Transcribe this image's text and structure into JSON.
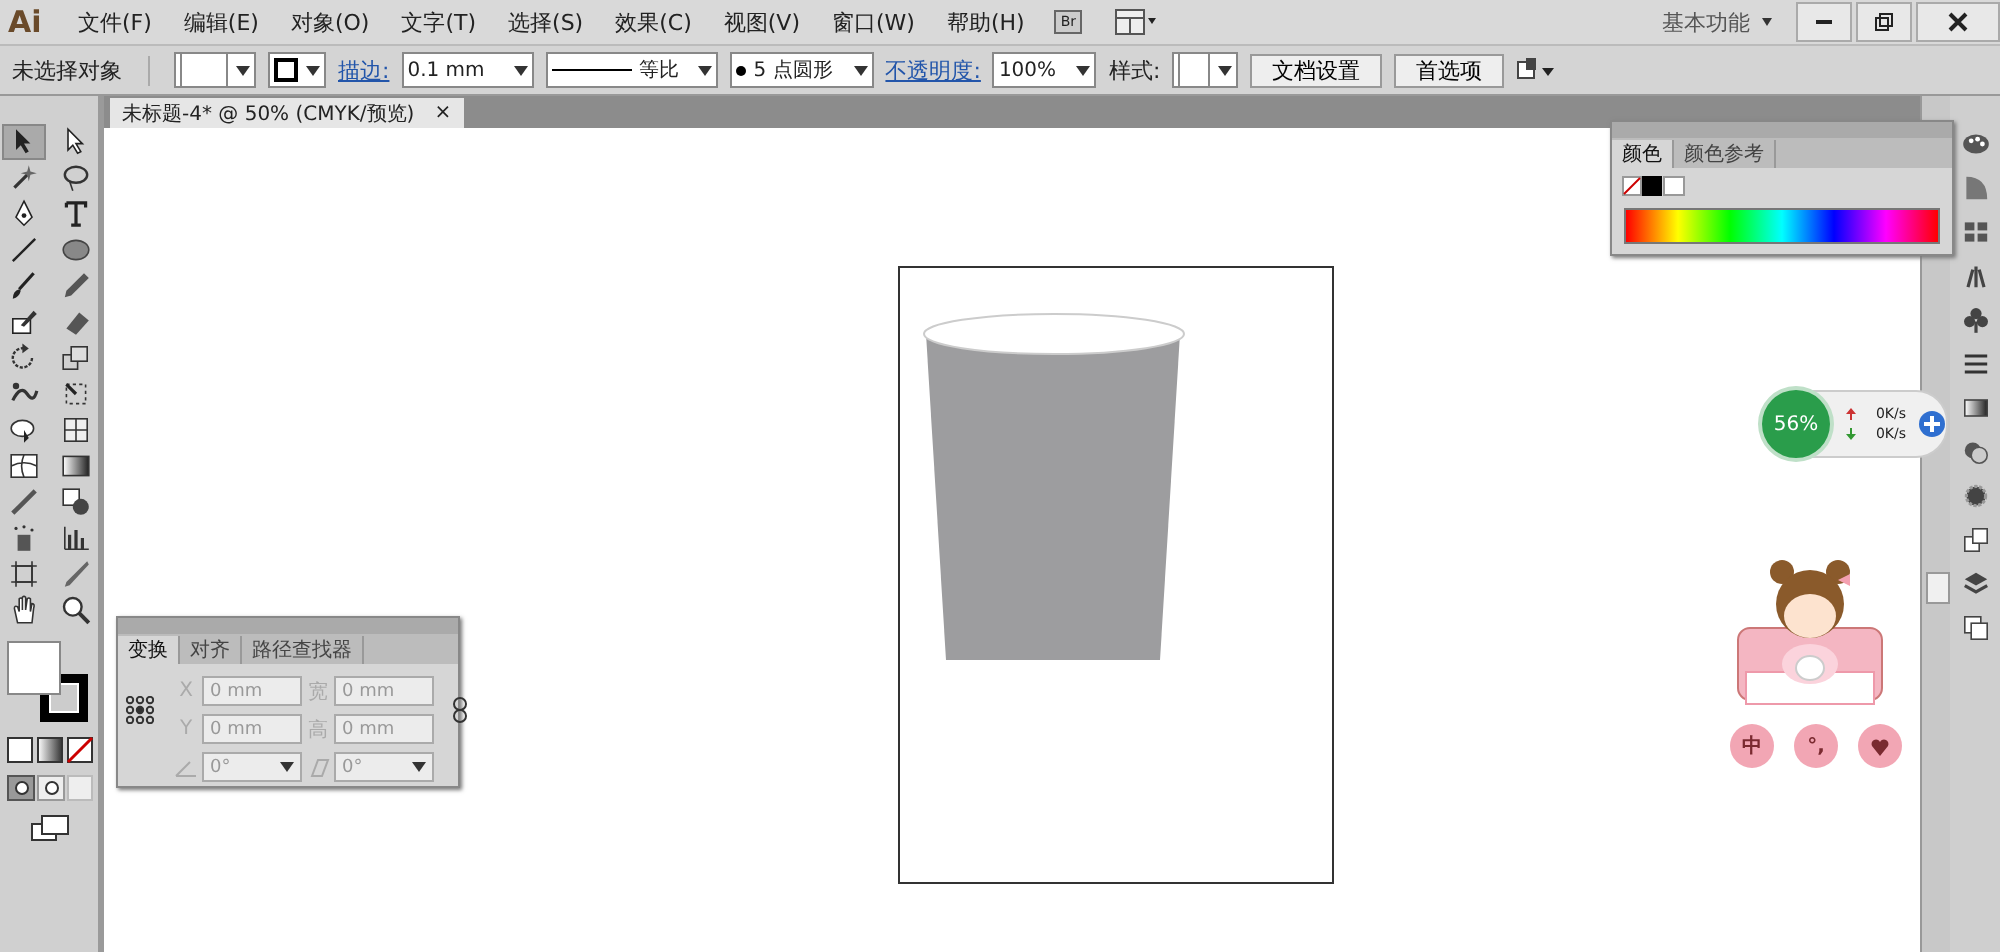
{
  "app": {
    "logo": "Ai",
    "bridge": "Br",
    "workspace": "基本功能"
  },
  "menu": [
    {
      "label": "文件(F)"
    },
    {
      "label": "编辑(E)"
    },
    {
      "label": "对象(O)"
    },
    {
      "label": "文字(T)"
    },
    {
      "label": "选择(S)"
    },
    {
      "label": "效果(C)"
    },
    {
      "label": "视图(V)"
    },
    {
      "label": "窗口(W)"
    },
    {
      "label": "帮助(H)"
    }
  ],
  "options_bar": {
    "selection": "未选择对象",
    "stroke_label": "描边:",
    "stroke_weight": "0.1 mm",
    "stroke_profile": "等比",
    "brush": "5 点圆形",
    "opacity_label": "不透明度:",
    "opacity": "100%",
    "style_label": "样式:",
    "buttons": [
      "文档设置",
      "首选项"
    ]
  },
  "document_tab": {
    "title": "未标题-4* @ 50% (CMYK/预览)",
    "close": "×"
  },
  "tools": [
    {
      "selected": true
    },
    {
      "selected": false
    },
    {
      "selected": false
    },
    {
      "selected": false
    },
    {
      "selected": false
    },
    {
      "selected": false
    },
    {
      "selected": false
    },
    {
      "selected": false
    },
    {
      "selected": false
    },
    {
      "selected": false
    },
    {
      "selected": false
    },
    {
      "selected": false
    },
    {
      "selected": false
    },
    {
      "selected": false
    },
    {
      "selected": false
    },
    {
      "selected": false
    },
    {
      "selected": false
    },
    {
      "selected": false
    },
    {
      "selected": false
    },
    {
      "selected": false
    },
    {
      "selected": false
    },
    {
      "selected": false
    },
    {
      "selected": false
    },
    {
      "selected": false
    },
    {
      "selected": false
    },
    {
      "selected": false
    },
    {
      "selected": false
    },
    {
      "selected": false
    }
  ],
  "color_panel": {
    "tabs": [
      {
        "label": "颜色",
        "selected": true
      },
      {
        "label": "颜色参考",
        "selected": false
      }
    ]
  },
  "transform_panel": {
    "tabs": [
      {
        "label": "变换",
        "selected": true
      },
      {
        "label": "对齐",
        "selected": false
      },
      {
        "label": "路径查找器",
        "selected": false
      }
    ],
    "fields": [
      {
        "label": "X",
        "value": "0 mm",
        "disabled": true
      },
      {
        "label": "宽",
        "value": "0 mm",
        "disabled": true
      },
      {
        "label": "Y",
        "value": "0 mm",
        "disabled": true
      },
      {
        "label": "高",
        "value": "0 mm",
        "disabled": true
      }
    ],
    "angles": [
      {
        "value": "0°",
        "disabled": true
      },
      {
        "value": "0°",
        "disabled": true
      }
    ]
  },
  "net_widget": {
    "percent": "56%",
    "up": "0K/s",
    "down": "0K/s"
  },
  "ime_bar": {
    "buttons": [
      "中",
      "°,"
    ]
  }
}
